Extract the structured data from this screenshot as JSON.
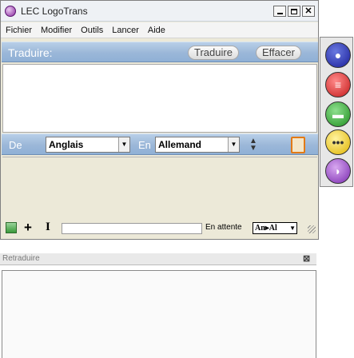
{
  "window": {
    "title": "LEC LogoTrans"
  },
  "menu": [
    "Fichier",
    "Modifier",
    "Outils",
    "Lancer",
    "Aide"
  ],
  "translate_bar": {
    "label": "Traduire:",
    "translate_button": "Traduire",
    "clear_button": "Effacer"
  },
  "language_bar": {
    "from_label": "De",
    "from_value": "Anglais",
    "to_label": "En",
    "to_value": "Allemand"
  },
  "status_bar": {
    "status_text": "En attente",
    "lang_indicator": "An▸Al"
  },
  "retranslate_panel": {
    "title": "Retraduire"
  },
  "side_toolbar": {
    "icons": [
      "person-icon",
      "book-icon",
      "hat-icon",
      "chat-icon",
      "speech-bubble-icon"
    ]
  }
}
